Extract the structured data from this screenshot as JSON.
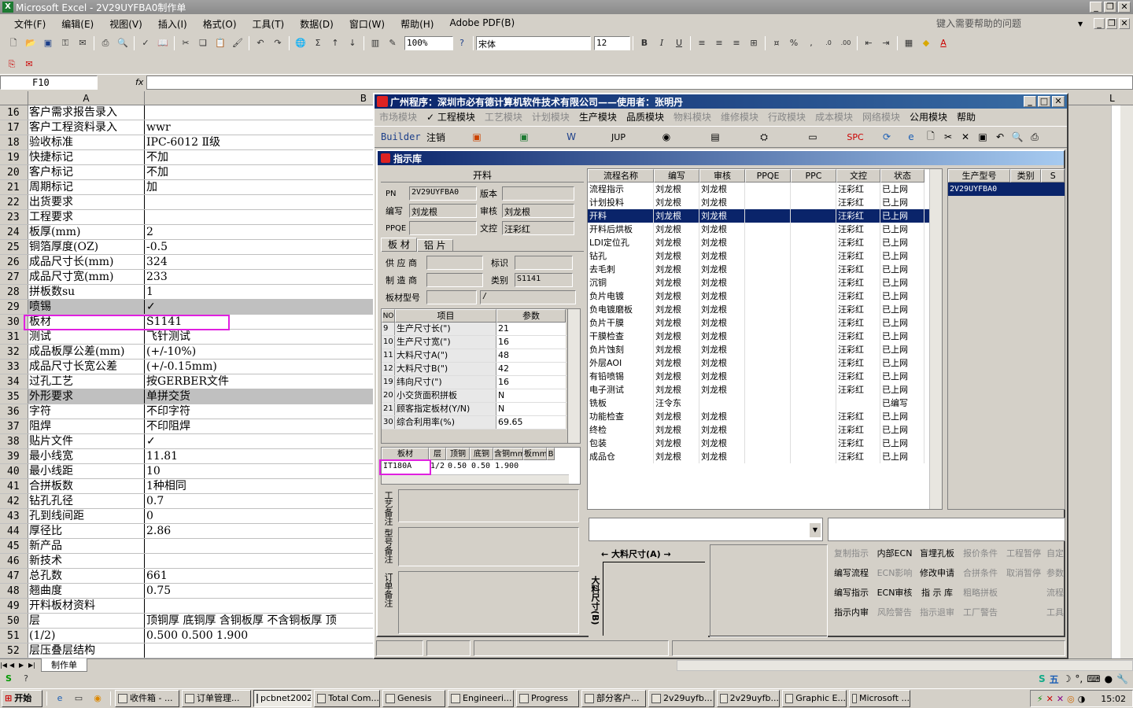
{
  "excel": {
    "title": "Microsoft Excel - 2V29UYFBA0制作单",
    "menu": [
      "文件(F)",
      "编辑(E)",
      "视图(V)",
      "插入(I)",
      "格式(O)",
      "工具(T)",
      "数据(D)",
      "窗口(W)",
      "帮助(H)",
      "Adobe PDF(B)"
    ],
    "help_placeholder": "键入需要帮助的问题",
    "zoom": "100%",
    "font": "宋体",
    "font_size": "12",
    "name_box": "F10",
    "fx": "fx",
    "col_a": "A",
    "col_b": "B",
    "col_l": "L",
    "rows": [
      {
        "n": "16",
        "a": "客户需求报告录入",
        "b": ""
      },
      {
        "n": "17",
        "a": "客户工程资料录入",
        "b": "wwr"
      },
      {
        "n": "18",
        "a": "验收标准",
        "b": "IPC-6012 Ⅱ级"
      },
      {
        "n": "19",
        "a": "快捷标记",
        "b": "不加"
      },
      {
        "n": "20",
        "a": "客户标记",
        "b": "不加"
      },
      {
        "n": "21",
        "a": "周期标记",
        "b": "加"
      },
      {
        "n": "22",
        "a": "出货要求",
        "b": ""
      },
      {
        "n": "23",
        "a": "工程要求",
        "b": ""
      },
      {
        "n": "24",
        "a": "板厚(mm)",
        "b": "2"
      },
      {
        "n": "25",
        "a": "铜箔厚度(OZ)",
        "b": "-0.5"
      },
      {
        "n": "26",
        "a": "成品尺寸长(mm)",
        "b": "324"
      },
      {
        "n": "27",
        "a": "成品尺寸宽(mm)",
        "b": "233"
      },
      {
        "n": "28",
        "a": "拼板数su",
        "b": "1"
      },
      {
        "n": "29",
        "a": "喷锡",
        "b": "✓"
      },
      {
        "n": "30",
        "a": "板材",
        "b": "S1141"
      },
      {
        "n": "31",
        "a": "测试",
        "b": "飞针测试"
      },
      {
        "n": "32",
        "a": "成品板厚公差(mm)",
        "b": "(+/-10%)"
      },
      {
        "n": "33",
        "a": "成品尺寸长宽公差",
        "b": "(+/-0.15mm)"
      },
      {
        "n": "34",
        "a": "过孔工艺",
        "b": "按GERBER文件"
      },
      {
        "n": "35",
        "a": "外形要求",
        "b": "单拼交货"
      },
      {
        "n": "36",
        "a": "字符",
        "b": "不印字符"
      },
      {
        "n": "37",
        "a": "阻焊",
        "b": "不印阻焊"
      },
      {
        "n": "38",
        "a": "贴片文件",
        "b": "✓"
      },
      {
        "n": "39",
        "a": "最小线宽",
        "b": "11.81"
      },
      {
        "n": "40",
        "a": "最小线距",
        "b": "10"
      },
      {
        "n": "41",
        "a": "合拼板数",
        "b": "1种相同"
      },
      {
        "n": "42",
        "a": "钻孔孔径",
        "b": "0.7"
      },
      {
        "n": "43",
        "a": "孔到线间距",
        "b": "0"
      },
      {
        "n": "44",
        "a": "厚径比",
        "b": "2.86"
      },
      {
        "n": "45",
        "a": "新产品",
        "b": ""
      },
      {
        "n": "46",
        "a": "新技术",
        "b": ""
      },
      {
        "n": "47",
        "a": "总孔数",
        "b": "661"
      },
      {
        "n": "48",
        "a": "翘曲度",
        "b": "0.75"
      },
      {
        "n": "49",
        "a": "开料板材资料",
        "b": ""
      },
      {
        "n": "50",
        "a": "层",
        "b": "顶铜厚  底铜厚  含铜板厚  不含铜板厚  顶"
      },
      {
        "n": "51",
        "a": "(1/2)",
        "b": "0.500  0.500   1.900"
      },
      {
        "n": "52",
        "a": "层压叠层结构",
        "b": ""
      }
    ],
    "sheet_tab": "制作单"
  },
  "app": {
    "title": "广州程序：深圳市必有德计算机软件技术有限公司——使用者：张明丹",
    "menus": [
      {
        "label": "市场模块",
        "dim": true
      },
      {
        "label": "✓ 工程模块",
        "dim": false
      },
      {
        "label": "工艺模块",
        "dim": true
      },
      {
        "label": "计划模块",
        "dim": true
      },
      {
        "label": "生产模块",
        "dim": false
      },
      {
        "label": "品质模块",
        "dim": false
      },
      {
        "label": "物料模块",
        "dim": true
      },
      {
        "label": "维修模块",
        "dim": true
      },
      {
        "label": "行政模块",
        "dim": true
      },
      {
        "label": "成本模块",
        "dim": true
      },
      {
        "label": "网络模块",
        "dim": true
      },
      {
        "label": "公用模块",
        "dim": false
      },
      {
        "label": "帮助",
        "dim": false
      }
    ],
    "toolbar": {
      "builder": "Builder",
      "logout": "注销",
      "jup": "JUP",
      "spc": "SPC"
    },
    "panel_title": "指示库",
    "section_title": "开料",
    "fields": {
      "pn_label": "PN",
      "pn": "2V29UYFBA0",
      "ver_label": "版本",
      "ver": "",
      "writer_label": "编写",
      "writer": "刘龙根",
      "review_label": "审核",
      "review": "刘龙根",
      "ppqe_label": "PPQE",
      "ppqe": "",
      "wk_label": "文控",
      "wk": "汪彩红"
    },
    "tabs": [
      "板 材",
      "铝 片"
    ],
    "supplier_label": "供 应 商",
    "supplier": "",
    "mark_label": "标识",
    "mark": "",
    "maker_label": "制 造 商",
    "maker": "",
    "cat_label": "类别",
    "cat": "S1141",
    "model_label": "板材型号",
    "model": "",
    "model2": "/",
    "param_head": [
      "NO",
      "项目",
      "参数"
    ],
    "params": [
      [
        "9",
        "生产尺寸长(\")",
        "21"
      ],
      [
        "10",
        "生产尺寸宽(\")",
        "16"
      ],
      [
        "11",
        "大料尺寸A(\")",
        "48"
      ],
      [
        "12",
        "大料尺寸B(\")",
        "42"
      ],
      [
        "19",
        "纬向尺寸(\")",
        "16"
      ],
      [
        "20",
        "小交货面积拼板",
        "N"
      ],
      [
        "21",
        "顾客指定板材(Y/N)",
        "N"
      ],
      [
        "30",
        "综合利用率(%)",
        "69.65"
      ]
    ],
    "mat_head": [
      "板材",
      "层",
      "顶铜",
      "底铜",
      "含铜mm",
      "板mm",
      "B"
    ],
    "mat_row": [
      "IT180A",
      "1/2",
      "0.50",
      "0.50",
      "1.900",
      "",
      ""
    ],
    "notes": [
      "工艺备注",
      "型号备注",
      "订单备注"
    ],
    "flow_head": [
      "流程名称",
      "编写",
      "审核",
      "PPQE",
      "PPC",
      "文控",
      "状态"
    ],
    "flows": [
      [
        "流程指示",
        "刘龙根",
        "刘龙根",
        "",
        "",
        "汪彩红",
        "已上网"
      ],
      [
        "计划投料",
        "刘龙根",
        "刘龙根",
        "",
        "",
        "汪彩红",
        "已上网"
      ],
      [
        "开料",
        "刘龙根",
        "刘龙根",
        "",
        "",
        "汪彩红",
        "已上网"
      ],
      [
        "开料后烘板",
        "刘龙根",
        "刘龙根",
        "",
        "",
        "汪彩红",
        "已上网"
      ],
      [
        "LDI定位孔",
        "刘龙根",
        "刘龙根",
        "",
        "",
        "汪彩红",
        "已上网"
      ],
      [
        "钻孔",
        "刘龙根",
        "刘龙根",
        "",
        "",
        "汪彩红",
        "已上网"
      ],
      [
        "去毛刺",
        "刘龙根",
        "刘龙根",
        "",
        "",
        "汪彩红",
        "已上网"
      ],
      [
        "沉铜",
        "刘龙根",
        "刘龙根",
        "",
        "",
        "汪彩红",
        "已上网"
      ],
      [
        "负片电镀",
        "刘龙根",
        "刘龙根",
        "",
        "",
        "汪彩红",
        "已上网"
      ],
      [
        "负电镀磨板",
        "刘龙根",
        "刘龙根",
        "",
        "",
        "汪彩红",
        "已上网"
      ],
      [
        "负片干膜",
        "刘龙根",
        "刘龙根",
        "",
        "",
        "汪彩红",
        "已上网"
      ],
      [
        "干膜检查",
        "刘龙根",
        "刘龙根",
        "",
        "",
        "汪彩红",
        "已上网"
      ],
      [
        "负片蚀刻",
        "刘龙根",
        "刘龙根",
        "",
        "",
        "汪彩红",
        "已上网"
      ],
      [
        "外层AOI",
        "刘龙根",
        "刘龙根",
        "",
        "",
        "汪彩红",
        "已上网"
      ],
      [
        "有铅喷锡",
        "刘龙根",
        "刘龙根",
        "",
        "",
        "汪彩红",
        "已上网"
      ],
      [
        "电子测试",
        "刘龙根",
        "刘龙根",
        "",
        "",
        "汪彩红",
        "已上网"
      ],
      [
        "铣板",
        "汪令东",
        "",
        "",
        "",
        "",
        "已编写"
      ],
      [
        "功能检查",
        "刘龙根",
        "刘龙根",
        "",
        "",
        "汪彩红",
        "已上网"
      ],
      [
        "终检",
        "刘龙根",
        "刘龙根",
        "",
        "",
        "汪彩红",
        "已上网"
      ],
      [
        "包装",
        "刘龙根",
        "刘龙根",
        "",
        "",
        "汪彩红",
        "已上网"
      ],
      [
        "成品仓",
        "刘龙根",
        "刘龙根",
        "",
        "",
        "汪彩红",
        "已上网"
      ]
    ],
    "right_head": [
      "生产型号",
      "类别",
      "S"
    ],
    "right_row": "2V29UYFBA0",
    "dim_label": "大料尺寸(A)",
    "dim_label_b": "大料尺寸(B)",
    "actions": [
      [
        {
          "t": "复制指示",
          "d": true
        },
        {
          "t": "内部ECN",
          "d": false
        },
        {
          "t": "盲埋孔板",
          "d": false
        },
        {
          "t": "报价条件",
          "d": true
        },
        {
          "t": "工程暂停",
          "d": true
        },
        {
          "t": "自定",
          "d": true
        }
      ],
      [
        {
          "t": "编写流程",
          "d": false
        },
        {
          "t": "ECN影响",
          "d": true
        },
        {
          "t": "修改申请",
          "d": false
        },
        {
          "t": "合拼条件",
          "d": true
        },
        {
          "t": "取消暂停",
          "d": true
        },
        {
          "t": "参数",
          "d": true
        }
      ],
      [
        {
          "t": "编写指示",
          "d": false
        },
        {
          "t": "ECN审核",
          "d": false
        },
        {
          "t": "指 示 库",
          "d": false
        },
        {
          "t": "粗略拼板",
          "d": true
        },
        {
          "t": "",
          "d": true
        },
        {
          "t": "流程",
          "d": true
        }
      ],
      [
        {
          "t": "指示内审",
          "d": false
        },
        {
          "t": "风险警告",
          "d": true
        },
        {
          "t": "指示退审",
          "d": true
        },
        {
          "t": "工厂警告",
          "d": true
        },
        {
          "t": "",
          "d": true
        },
        {
          "t": "工具",
          "d": true
        }
      ]
    ]
  },
  "taskbar": {
    "start": "开始",
    "items": [
      "收件箱 - ...",
      "订单管理...",
      "pcbnet2002",
      "Total Com...",
      "Genesis",
      "Engineeri...",
      "Progress",
      "部分客户...",
      "2v29uyfb...",
      "2v29uyfb...",
      "Graphic E...",
      "Microsoft ..."
    ],
    "clock": "15:02"
  },
  "ime": {
    "label": "五"
  }
}
